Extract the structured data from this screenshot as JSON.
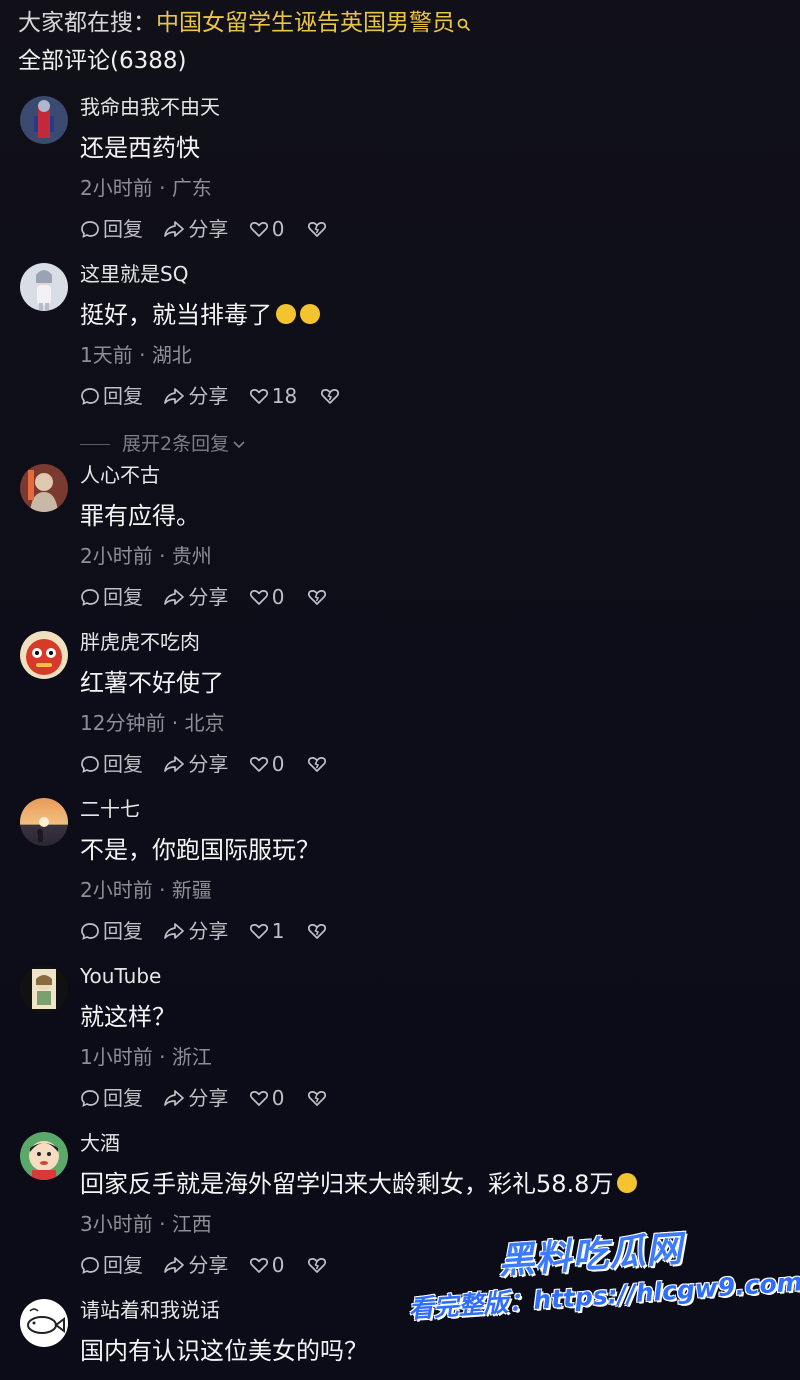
{
  "header": {
    "search_prefix": "大家都在搜：",
    "search_topic": "中国女留学生诬告英国男警员",
    "comment_count": "全部评论(6388)"
  },
  "actions": {
    "reply": "回复",
    "share": "分享"
  },
  "comments": [
    {
      "user": "我命由我不由天",
      "text": "还是西药快",
      "emoji": false,
      "time": "2小时前",
      "location": "广东",
      "likes": "0"
    },
    {
      "user": "这里就是SQ",
      "text": "挺好，就当排毒了",
      "emoji": true,
      "time": "1天前",
      "location": "湖北",
      "likes": "18",
      "expand": "展开2条回复"
    },
    {
      "user": "人心不古",
      "text": "罪有应得。",
      "emoji": false,
      "time": "2小时前",
      "location": "贵州",
      "likes": "0"
    },
    {
      "user": "胖虎虎不吃肉",
      "text": "红薯不好使了",
      "emoji": false,
      "time": "12分钟前",
      "location": "北京",
      "likes": "0"
    },
    {
      "user": "二十七",
      "text": "不是，你跑国际服玩？",
      "emoji": false,
      "time": "2小时前",
      "location": "新疆",
      "likes": "1"
    },
    {
      "user": "YouTube",
      "text": "就这样？",
      "emoji": false,
      "time": "1小时前",
      "location": "浙江",
      "likes": "0"
    },
    {
      "user": "大酒",
      "text": "回家反手就是海外留学归来大龄剩女，彩礼58.8万",
      "emoji": true,
      "time": "3小时前",
      "location": "江西",
      "likes": "0"
    },
    {
      "user": "请站着和我说话",
      "text": "国内有认识这位美女的吗？",
      "emoji": false,
      "time": "",
      "location": "",
      "likes": ""
    }
  ],
  "watermark": {
    "title": "黑料吃瓜网",
    "url": "看完整版：https://hlcgw9.com"
  },
  "colors": {
    "accent": "#e8c547",
    "background": "#0e0e16",
    "watermark": "#2f6fff"
  }
}
